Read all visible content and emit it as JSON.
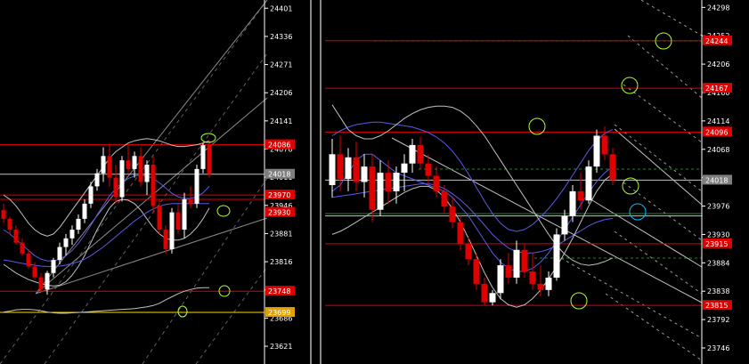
{
  "colors": {
    "background": "#000000",
    "axis": "#FFFFFF",
    "bull": "#FFFFFF",
    "bear": "#E00000",
    "redline": "#E00000",
    "silverline": "#C0C0C0",
    "blue": "#5A5AE6",
    "green": "#2E7D32",
    "yellow": "#FFD700",
    "highlightCircle": "#ADFF2F",
    "cyanCircle": "#00BFFF",
    "labelRed": "#E00000",
    "labelGray": "#7F7F7F",
    "labelOrange": "#E4A000",
    "separator": "#8A8A8A"
  },
  "chart_data": [
    {
      "type": "candlestick",
      "title": "",
      "y_ticks": [
        24401,
        24336,
        24271,
        24206,
        24141,
        24076,
        24011,
        23946,
        23881,
        23816,
        23751,
        23686,
        23621
      ],
      "ylim": [
        23580,
        24420
      ],
      "price_labels": [
        {
          "text": "24086",
          "value": 24086,
          "bg": "labelRed"
        },
        {
          "text": "24018",
          "value": 24018,
          "bg": "labelGray"
        },
        {
          "text": "23970",
          "value": 23970,
          "bg": "labelRed"
        },
        {
          "text": "23930",
          "value": 23930,
          "bg": "labelRed"
        },
        {
          "text": "23748",
          "value": 23748,
          "bg": "labelRed"
        },
        {
          "text": "23699",
          "value": 23699,
          "bg": "labelOrange"
        }
      ],
      "horizontal_lines": [
        {
          "value": 24086,
          "color": "redline"
        },
        {
          "value": 24018,
          "color": "silverline"
        },
        {
          "value": 23970,
          "color": "redline"
        },
        {
          "value": 23960,
          "color": "redline"
        },
        {
          "value": 23748,
          "color": "redline"
        },
        {
          "value": 23699,
          "color": "yellow"
        }
      ],
      "candles": [
        {
          "o": 23935,
          "h": 23950,
          "l": 23905,
          "c": 23915
        },
        {
          "o": 23915,
          "h": 23920,
          "l": 23880,
          "c": 23890
        },
        {
          "o": 23890,
          "h": 23900,
          "l": 23855,
          "c": 23860
        },
        {
          "o": 23860,
          "h": 23870,
          "l": 23830,
          "c": 23835
        },
        {
          "o": 23835,
          "h": 23845,
          "l": 23800,
          "c": 23805
        },
        {
          "o": 23805,
          "h": 23815,
          "l": 23775,
          "c": 23780
        },
        {
          "o": 23780,
          "h": 23790,
          "l": 23745,
          "c": 23752
        },
        {
          "o": 23752,
          "h": 23795,
          "l": 23740,
          "c": 23790
        },
        {
          "o": 23790,
          "h": 23825,
          "l": 23780,
          "c": 23820
        },
        {
          "o": 23820,
          "h": 23860,
          "l": 23810,
          "c": 23850
        },
        {
          "o": 23850,
          "h": 23880,
          "l": 23830,
          "c": 23870
        },
        {
          "o": 23870,
          "h": 23900,
          "l": 23855,
          "c": 23890
        },
        {
          "o": 23890,
          "h": 23925,
          "l": 23880,
          "c": 23915
        },
        {
          "o": 23915,
          "h": 23960,
          "l": 23905,
          "c": 23950
        },
        {
          "o": 23950,
          "h": 24000,
          "l": 23940,
          "c": 23990
        },
        {
          "o": 23990,
          "h": 24030,
          "l": 23980,
          "c": 24020
        },
        {
          "o": 24020,
          "h": 24080,
          "l": 24000,
          "c": 24060
        },
        {
          "o": 24060,
          "h": 24086,
          "l": 23990,
          "c": 24010
        },
        {
          "o": 24010,
          "h": 24040,
          "l": 23950,
          "c": 23965
        },
        {
          "o": 23965,
          "h": 24060,
          "l": 23955,
          "c": 24050
        },
        {
          "o": 24050,
          "h": 24086,
          "l": 24020,
          "c": 24030
        },
        {
          "o": 24030,
          "h": 24070,
          "l": 24010,
          "c": 24060
        },
        {
          "o": 24060,
          "h": 24080,
          "l": 23990,
          "c": 24000
        },
        {
          "o": 24000,
          "h": 24050,
          "l": 23970,
          "c": 24040
        },
        {
          "o": 24040,
          "h": 24060,
          "l": 23930,
          "c": 23945
        },
        {
          "o": 23945,
          "h": 23960,
          "l": 23880,
          "c": 23890
        },
        {
          "o": 23890,
          "h": 23900,
          "l": 23835,
          "c": 23845
        },
        {
          "o": 23845,
          "h": 23940,
          "l": 23835,
          "c": 23930
        },
        {
          "o": 23930,
          "h": 23950,
          "l": 23880,
          "c": 23890
        },
        {
          "o": 23890,
          "h": 23975,
          "l": 23870,
          "c": 23960
        },
        {
          "o": 23960,
          "h": 23990,
          "l": 23940,
          "c": 23950
        },
        {
          "o": 23950,
          "h": 24040,
          "l": 23940,
          "c": 24030
        },
        {
          "o": 24030,
          "h": 24090,
          "l": 24020,
          "c": 24085
        },
        {
          "o": 24085,
          "h": 24095,
          "l": 24010,
          "c": 24018
        }
      ],
      "bands": [
        {
          "color": "silverline",
          "pts": [
            23970,
            23960,
            23945,
            23925,
            23905,
            23890,
            23880,
            23875,
            23880,
            23895,
            23915,
            23935,
            23955,
            23975,
            23995,
            24015,
            24035,
            24055,
            24070,
            24080,
            24090,
            24095,
            24098,
            24100,
            24098,
            24095,
            24090,
            24085,
            24082,
            24082,
            24084,
            24086,
            24090,
            24095
          ]
        },
        {
          "color": "silverline",
          "pts": [
            23810,
            23800,
            23790,
            23782,
            23775,
            23770,
            23765,
            23762,
            23760,
            23762,
            23770,
            23785,
            23805,
            23830,
            23860,
            23890,
            23915,
            23940,
            23955,
            23960,
            23958,
            23950,
            23935,
            23915,
            23895,
            23880,
            23870,
            23866,
            23866,
            23870,
            23880,
            23895,
            23915,
            23940
          ]
        },
        {
          "color": "blue",
          "pts": [
            23890,
            23880,
            23868,
            23855,
            23842,
            23830,
            23822,
            23818,
            23818,
            23822,
            23830,
            23842,
            23858,
            23878,
            23900,
            23924,
            23946,
            23968,
            23985,
            23998,
            24008,
            24014,
            24016,
            24014,
            24008,
            23998,
            23986,
            23974,
            23966,
            23962,
            23962,
            23966,
            23975,
            23990
          ]
        },
        {
          "color": "blue",
          "pts": [
            23820,
            23818,
            23815,
            23812,
            23810,
            23808,
            23806,
            23805,
            23805,
            23806,
            23808,
            23812,
            23816,
            23822,
            23830,
            23840,
            23850,
            23862,
            23874,
            23886,
            23898,
            23910,
            23920,
            23930,
            23938,
            23944,
            23948,
            23950,
            23950,
            23950,
            23950,
            23950,
            23950,
            23950
          ]
        },
        {
          "color": "silverline",
          "pts": [
            23700,
            23702,
            23705,
            23706,
            23706,
            23705,
            23703,
            23700,
            23698,
            23697,
            23697,
            23698,
            23699,
            23700,
            23701,
            23702,
            23703,
            23704,
            23705,
            23706,
            23707,
            23708,
            23710,
            23712,
            23715,
            23720,
            23728,
            23735,
            23742,
            23748,
            23752,
            23755,
            23756,
            23756
          ]
        }
      ]
    },
    {
      "type": "candlestick",
      "title": "",
      "y_ticks": [
        24298,
        24252,
        24206,
        24160,
        24114,
        24068,
        24022,
        23976,
        23930,
        23884,
        23838,
        23792,
        23746
      ],
      "ylim": [
        23720,
        24310
      ],
      "price_labels": [
        {
          "text": "24244",
          "value": 24244,
          "bg": "labelRed"
        },
        {
          "text": "24167",
          "value": 24167,
          "bg": "labelRed"
        },
        {
          "text": "24096",
          "value": 24096,
          "bg": "labelRed"
        },
        {
          "text": "24018",
          "value": 24018,
          "bg": "labelGray"
        },
        {
          "text": "23915",
          "value": 23915,
          "bg": "labelRed"
        },
        {
          "text": "23815",
          "value": 23815,
          "bg": "labelRed"
        }
      ],
      "horizontal_lines": [
        {
          "value": 24244,
          "color": "redline"
        },
        {
          "value": 24167,
          "color": "redline"
        },
        {
          "value": 24096,
          "color": "redline"
        },
        {
          "value": 23915,
          "color": "redline"
        },
        {
          "value": 23815,
          "color": "redline"
        },
        {
          "value": 24018,
          "color": "silverline"
        },
        {
          "value": 23960,
          "color": "silverline"
        }
      ],
      "candles": [
        {
          "o": 24010,
          "h": 24085,
          "l": 23990,
          "c": 24060
        },
        {
          "o": 24060,
          "h": 24090,
          "l": 24000,
          "c": 24020
        },
        {
          "o": 24020,
          "h": 24070,
          "l": 24000,
          "c": 24055
        },
        {
          "o": 24055,
          "h": 24080,
          "l": 24000,
          "c": 24015
        },
        {
          "o": 24015,
          "h": 24060,
          "l": 23990,
          "c": 24040
        },
        {
          "o": 24040,
          "h": 24060,
          "l": 23950,
          "c": 23970
        },
        {
          "o": 23970,
          "h": 24050,
          "l": 23960,
          "c": 24030
        },
        {
          "o": 24030,
          "h": 24050,
          "l": 23980,
          "c": 24000
        },
        {
          "o": 24000,
          "h": 24040,
          "l": 23980,
          "c": 24030
        },
        {
          "o": 24030,
          "h": 24060,
          "l": 24000,
          "c": 24045
        },
        {
          "o": 24045,
          "h": 24085,
          "l": 24030,
          "c": 24075
        },
        {
          "o": 24075,
          "h": 24088,
          "l": 24035,
          "c": 24045
        },
        {
          "o": 24045,
          "h": 24060,
          "l": 24010,
          "c": 24025
        },
        {
          "o": 24025,
          "h": 24040,
          "l": 23990,
          "c": 24000
        },
        {
          "o": 24000,
          "h": 24010,
          "l": 23965,
          "c": 23975
        },
        {
          "o": 23975,
          "h": 23990,
          "l": 23940,
          "c": 23950
        },
        {
          "o": 23950,
          "h": 23960,
          "l": 23905,
          "c": 23915
        },
        {
          "o": 23915,
          "h": 23925,
          "l": 23880,
          "c": 23890
        },
        {
          "o": 23890,
          "h": 23900,
          "l": 23840,
          "c": 23850
        },
        {
          "o": 23850,
          "h": 23860,
          "l": 23815,
          "c": 23820
        },
        {
          "o": 23820,
          "h": 23840,
          "l": 23815,
          "c": 23835
        },
        {
          "o": 23835,
          "h": 23890,
          "l": 23825,
          "c": 23880
        },
        {
          "o": 23880,
          "h": 23900,
          "l": 23850,
          "c": 23860
        },
        {
          "o": 23860,
          "h": 23920,
          "l": 23850,
          "c": 23905
        },
        {
          "o": 23905,
          "h": 23915,
          "l": 23860,
          "c": 23870
        },
        {
          "o": 23870,
          "h": 23900,
          "l": 23840,
          "c": 23850
        },
        {
          "o": 23850,
          "h": 23880,
          "l": 23830,
          "c": 23840
        },
        {
          "o": 23840,
          "h": 23870,
          "l": 23830,
          "c": 23860
        },
        {
          "o": 23860,
          "h": 23940,
          "l": 23855,
          "c": 23930
        },
        {
          "o": 23930,
          "h": 23970,
          "l": 23920,
          "c": 23960
        },
        {
          "o": 23960,
          "h": 24010,
          "l": 23950,
          "c": 24000
        },
        {
          "o": 24000,
          "h": 24030,
          "l": 23970,
          "c": 23985
        },
        {
          "o": 23985,
          "h": 24050,
          "l": 23980,
          "c": 24040
        },
        {
          "o": 24040,
          "h": 24100,
          "l": 24030,
          "c": 24090
        },
        {
          "o": 24090,
          "h": 24105,
          "l": 24050,
          "c": 24060
        },
        {
          "o": 24060,
          "h": 24070,
          "l": 24010,
          "c": 24018
        }
      ],
      "bands": [
        {
          "color": "blue",
          "pts": [
            24090,
            24098,
            24104,
            24108,
            24110,
            24112,
            24112,
            24110,
            24108,
            24106,
            24104,
            24100,
            24095,
            24088,
            24078,
            24065,
            24048,
            24028,
            24006,
            23984,
            23964,
            23948,
            23938,
            23935,
            23938,
            23946,
            23958,
            23972,
            23988,
            24006,
            24026,
            24046,
            24066,
            24082,
            24094,
            24100
          ]
        },
        {
          "color": "blue",
          "pts": [
            23990,
            23992,
            23994,
            23996,
            23998,
            24000,
            24002,
            24004,
            24006,
            24008,
            24010,
            24012,
            24012,
            24010,
            24004,
            23996,
            23986,
            23974,
            23960,
            23945,
            23930,
            23918,
            23908,
            23902,
            23900,
            23900,
            23902,
            23906,
            23912,
            23920,
            23928,
            23936,
            23944,
            23950,
            23954,
            23956
          ]
        },
        {
          "color": "silverline",
          "pts": [
            23930,
            23935,
            23942,
            23950,
            23958,
            23966,
            23974,
            23982,
            23990,
            23998,
            24004,
            24008,
            24008,
            24002,
            23990,
            23972,
            23950,
            23924,
            23896,
            23868,
            23844,
            23826,
            23816,
            23812,
            23816,
            23826,
            23840,
            23858,
            23878,
            23900,
            23924,
            23950,
            23976,
            24000,
            24018,
            24028
          ]
        },
        {
          "color": "silverline",
          "pts": [
            24140,
            24120,
            24100,
            24090,
            24085,
            24085,
            24090,
            24098,
            24108,
            24118,
            24126,
            24132,
            24136,
            24138,
            24138,
            24136,
            24130,
            24120,
            24106,
            24090,
            24070,
            24050,
            24030,
            24010,
            23990,
            23970,
            23950,
            23930,
            23912,
            23898,
            23888,
            23882,
            23880,
            23882,
            23886,
            23892
          ]
        },
        {
          "color": "blue",
          "pts": [
            24000,
            24010,
            24030,
            24050,
            24060,
            24060,
            24050,
            24040,
            24030,
            24025,
            24020,
            24015,
            24010,
            24005,
            24000,
            23990,
            23975,
            23960,
            23940,
            23920,
            23900,
            23885,
            23875,
            23870,
            23870,
            23875,
            23885,
            23900,
            23918,
            23938,
            23958,
            23978,
            23998,
            24016,
            24030,
            24040
          ]
        }
      ]
    }
  ]
}
